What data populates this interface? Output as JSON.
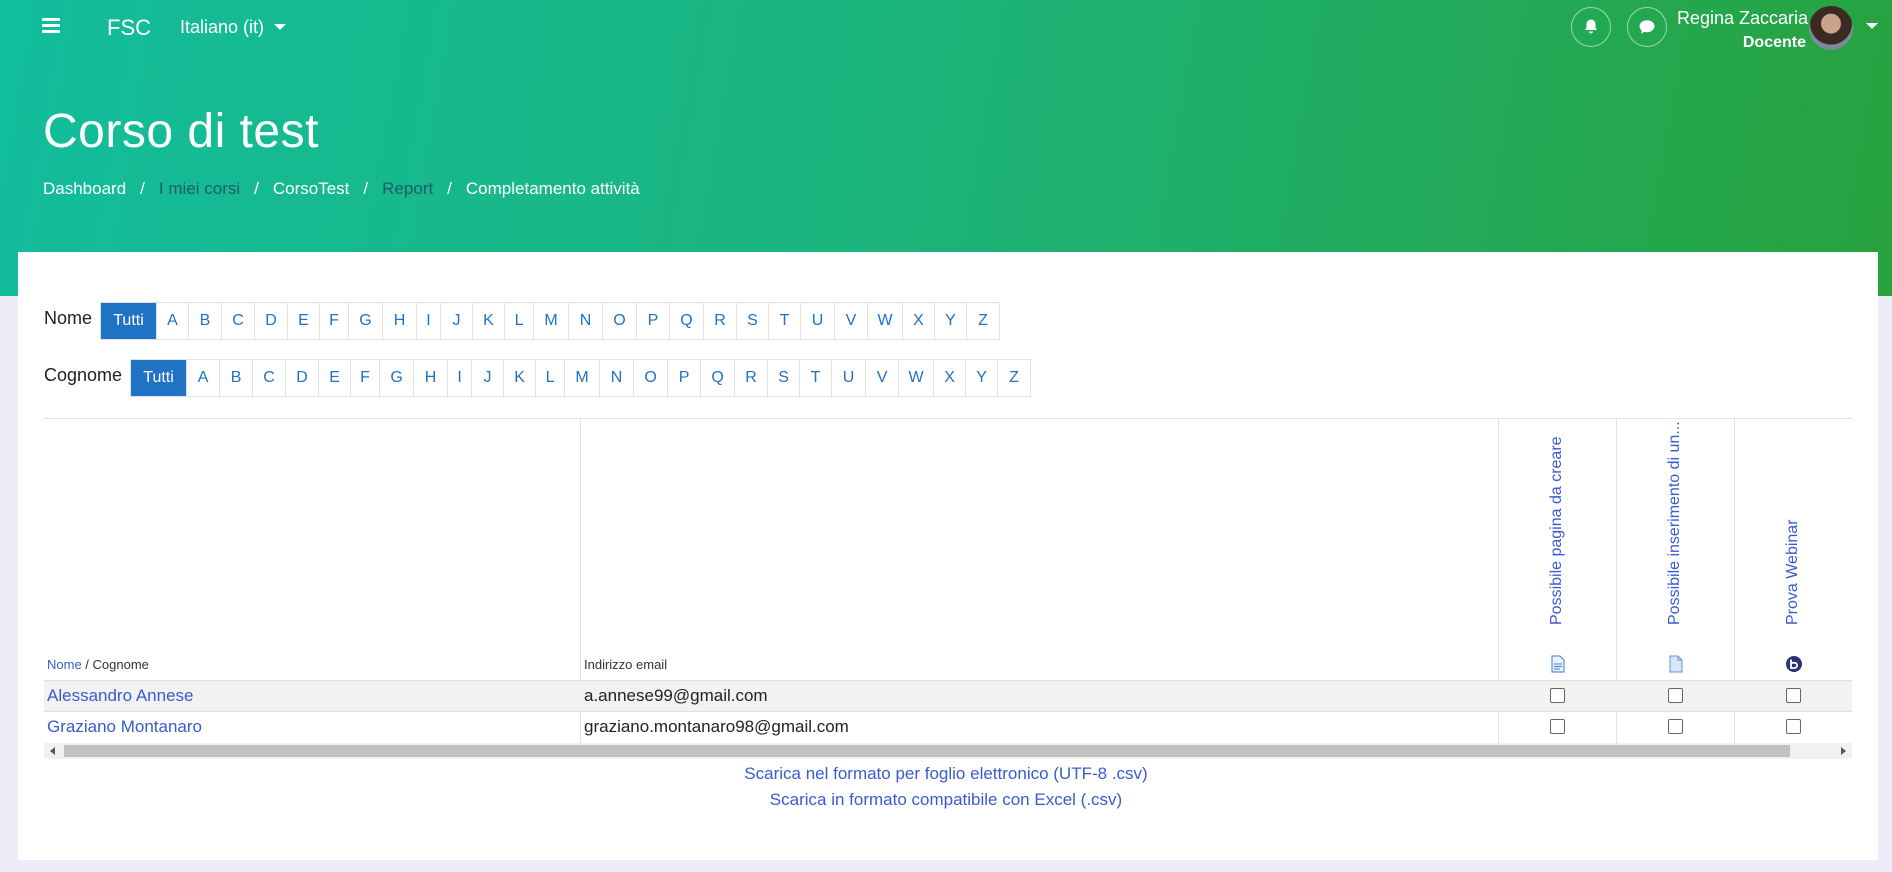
{
  "navbar": {
    "brand": "FSC",
    "language": "Italiano (it)",
    "user_name": "Regina Zaccaria",
    "user_role": "Docente"
  },
  "header": {
    "title": "Corso di test",
    "breadcrumb": [
      "Dashboard",
      "I miei corsi",
      "CorsoTest",
      "Report",
      "Completamento attività"
    ]
  },
  "filters": {
    "first_name_label": "Nome",
    "last_name_label": "Cognome",
    "all_label": "Tutti",
    "letters": [
      "A",
      "B",
      "C",
      "D",
      "E",
      "F",
      "G",
      "H",
      "I",
      "J",
      "K",
      "L",
      "M",
      "N",
      "O",
      "P",
      "Q",
      "R",
      "S",
      "T",
      "U",
      "V",
      "W",
      "X",
      "Y",
      "Z"
    ]
  },
  "table": {
    "col_name_sort": "Nome",
    "col_name_sep": " / ",
    "col_lastname": "Cognome",
    "col_email": "Indirizzo email",
    "activities": [
      {
        "label": "Possibile pagina da creare",
        "icon": "page-icon"
      },
      {
        "label": "Possibile inserimento di un...",
        "icon": "file-icon"
      },
      {
        "label": "Prova Webinar",
        "icon": "bigbluebutton-icon"
      }
    ],
    "rows": [
      {
        "name": "Alessandro Annese",
        "email": "a.annese99@gmail.com",
        "completed": [
          false,
          false,
          false
        ]
      },
      {
        "name": "Graziano Montanaro",
        "email": "graziano.montanaro98@gmail.com",
        "completed": [
          false,
          false,
          false
        ]
      }
    ]
  },
  "downloads": {
    "csv_utf8": "Scarica nel formato per foglio elettronico (UTF-8 .csv)",
    "csv_excel": "Scarica in formato compatibile con Excel (.csv)"
  },
  "colors": {
    "gradient_start": "#12bd9c",
    "gradient_end": "#27a23e",
    "primary": "#1f72c4",
    "link": "#3a5bd0"
  }
}
